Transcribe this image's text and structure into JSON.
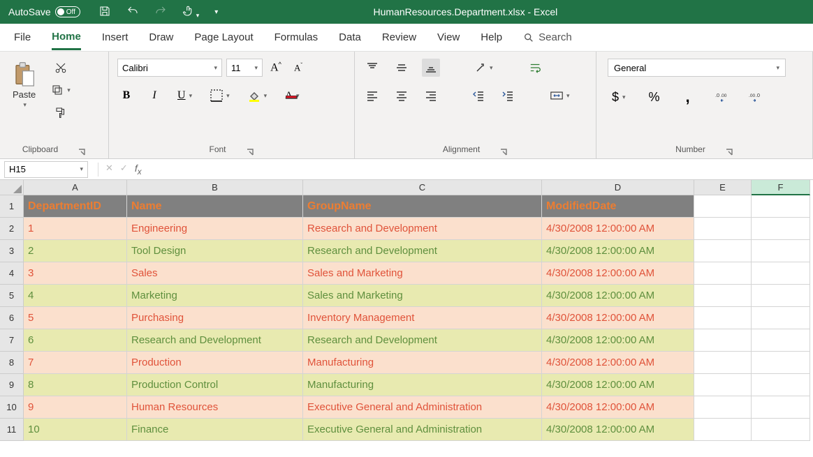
{
  "titlebar": {
    "autosave_label": "AutoSave",
    "autosave_state": "Off",
    "doc_title": "HumanResources.Department.xlsx - Excel"
  },
  "tabs": {
    "file": "File",
    "home": "Home",
    "insert": "Insert",
    "draw": "Draw",
    "pagelayout": "Page Layout",
    "formulas": "Formulas",
    "data": "Data",
    "review": "Review",
    "view": "View",
    "help": "Help",
    "search": "Search"
  },
  "ribbon": {
    "clipboard": {
      "paste": "Paste",
      "label": "Clipboard"
    },
    "font": {
      "name": "Calibri",
      "size": "11",
      "label": "Font"
    },
    "alignment": {
      "label": "Alignment"
    },
    "number": {
      "format": "General",
      "label": "Number"
    }
  },
  "formula_bar": {
    "cell_ref": "H15",
    "formula": ""
  },
  "grid": {
    "columns": [
      "A",
      "B",
      "C",
      "D",
      "E",
      "F"
    ],
    "headers": [
      "DepartmentID",
      "Name",
      "GroupName",
      "ModifiedDate"
    ],
    "rows": [
      {
        "id": "1",
        "name": "Engineering",
        "group": "Research and Development",
        "date": "4/30/2008 12:00:00 AM"
      },
      {
        "id": "2",
        "name": "Tool Design",
        "group": "Research and Development",
        "date": "4/30/2008 12:00:00 AM"
      },
      {
        "id": "3",
        "name": "Sales",
        "group": "Sales and Marketing",
        "date": "4/30/2008 12:00:00 AM"
      },
      {
        "id": "4",
        "name": "Marketing",
        "group": "Sales and Marketing",
        "date": "4/30/2008 12:00:00 AM"
      },
      {
        "id": "5",
        "name": "Purchasing",
        "group": "Inventory Management",
        "date": "4/30/2008 12:00:00 AM"
      },
      {
        "id": "6",
        "name": "Research and Development",
        "group": "Research and Development",
        "date": "4/30/2008 12:00:00 AM"
      },
      {
        "id": "7",
        "name": "Production",
        "group": "Manufacturing",
        "date": "4/30/2008 12:00:00 AM"
      },
      {
        "id": "8",
        "name": "Production Control",
        "group": "Manufacturing",
        "date": "4/30/2008 12:00:00 AM"
      },
      {
        "id": "9",
        "name": "Human Resources",
        "group": "Executive General and Administration",
        "date": "4/30/2008 12:00:00 AM"
      },
      {
        "id": "10",
        "name": "Finance",
        "group": "Executive General and Administration",
        "date": "4/30/2008 12:00:00 AM"
      }
    ]
  }
}
